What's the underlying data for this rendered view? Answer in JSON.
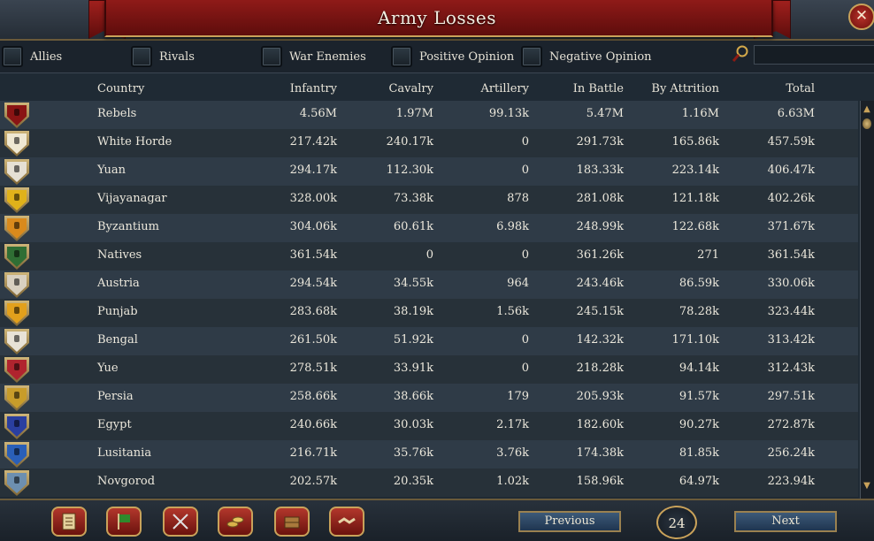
{
  "window": {
    "title": "Army Losses",
    "close_icon": "close-icon"
  },
  "filters": [
    {
      "label": "Allies"
    },
    {
      "label": "Rivals"
    },
    {
      "label": "War Enemies"
    },
    {
      "label": "Positive Opinion"
    },
    {
      "label": "Negative Opinion"
    }
  ],
  "search": {
    "icon": "search-icon",
    "value": ""
  },
  "table": {
    "headers": [
      "Country",
      "Infantry",
      "Cavalry",
      "Artillery",
      "In Battle",
      "By Attrition",
      "Total"
    ],
    "rows": [
      {
        "country": "Rebels",
        "infantry": "4.56M",
        "cavalry": "1.97M",
        "artillery": "99.13k",
        "in_battle": "5.47M",
        "by_attrition": "1.16M",
        "total": "6.63M",
        "flag": "#8a1414"
      },
      {
        "country": "White Horde",
        "infantry": "217.42k",
        "cavalry": "240.17k",
        "artillery": "0",
        "in_battle": "291.73k",
        "by_attrition": "165.86k",
        "total": "457.59k",
        "flag": "#efe8d2"
      },
      {
        "country": "Yuan",
        "infantry": "294.17k",
        "cavalry": "112.30k",
        "artillery": "0",
        "in_battle": "183.33k",
        "by_attrition": "223.14k",
        "total": "406.47k",
        "flag": "#e6e0d4"
      },
      {
        "country": "Vijayanagar",
        "infantry": "328.00k",
        "cavalry": "73.38k",
        "artillery": "878",
        "in_battle": "281.08k",
        "by_attrition": "121.18k",
        "total": "402.26k",
        "flag": "#e0b21a"
      },
      {
        "country": "Byzantium",
        "infantry": "304.06k",
        "cavalry": "60.61k",
        "artillery": "6.98k",
        "in_battle": "248.99k",
        "by_attrition": "122.68k",
        "total": "371.67k",
        "flag": "#d98a1c"
      },
      {
        "country": "Natives",
        "infantry": "361.54k",
        "cavalry": "0",
        "artillery": "0",
        "in_battle": "361.26k",
        "by_attrition": "271",
        "total": "361.54k",
        "flag": "#2f6e34"
      },
      {
        "country": "Austria",
        "infantry": "294.54k",
        "cavalry": "34.55k",
        "artillery": "964",
        "in_battle": "243.46k",
        "by_attrition": "86.59k",
        "total": "330.06k",
        "flag": "#d8d0c0"
      },
      {
        "country": "Punjab",
        "infantry": "283.68k",
        "cavalry": "38.19k",
        "artillery": "1.56k",
        "in_battle": "245.15k",
        "by_attrition": "78.28k",
        "total": "323.44k",
        "flag": "#e2a01c"
      },
      {
        "country": "Bengal",
        "infantry": "261.50k",
        "cavalry": "51.92k",
        "artillery": "0",
        "in_battle": "142.32k",
        "by_attrition": "171.10k",
        "total": "313.42k",
        "flag": "#e8e2d6"
      },
      {
        "country": "Yue",
        "infantry": "278.51k",
        "cavalry": "33.91k",
        "artillery": "0",
        "in_battle": "218.28k",
        "by_attrition": "94.14k",
        "total": "312.43k",
        "flag": "#b0242e"
      },
      {
        "country": "Persia",
        "infantry": "258.66k",
        "cavalry": "38.66k",
        "artillery": "179",
        "in_battle": "205.93k",
        "by_attrition": "91.57k",
        "total": "297.51k",
        "flag": "#c89c2a"
      },
      {
        "country": "Egypt",
        "infantry": "240.66k",
        "cavalry": "30.03k",
        "artillery": "2.17k",
        "in_battle": "182.60k",
        "by_attrition": "90.27k",
        "total": "272.87k",
        "flag": "#2a3fa0"
      },
      {
        "country": "Lusitania",
        "infantry": "216.71k",
        "cavalry": "35.76k",
        "artillery": "3.76k",
        "in_battle": "174.38k",
        "by_attrition": "81.85k",
        "total": "256.24k",
        "flag": "#2a5fb8"
      },
      {
        "country": "Novgorod",
        "infantry": "202.57k",
        "cavalry": "20.35k",
        "artillery": "1.02k",
        "in_battle": "158.96k",
        "by_attrition": "64.97k",
        "total": "223.94k",
        "flag": "#6d8fb0"
      }
    ]
  },
  "toolbar": {
    "buttons": [
      {
        "icon": "ledger-icon"
      },
      {
        "icon": "flag-icon"
      },
      {
        "icon": "crossed-swords-icon"
      },
      {
        "icon": "coins-icon"
      },
      {
        "icon": "crate-icon"
      },
      {
        "icon": "handshake-icon"
      }
    ]
  },
  "pagination": {
    "previous_label": "Previous",
    "next_label": "Next",
    "page": "24"
  },
  "colors": {
    "banner": "#8f1a18",
    "gold_trim": "#c9a25a",
    "row_light": "#2f3b47",
    "row_dark": "#273139"
  }
}
